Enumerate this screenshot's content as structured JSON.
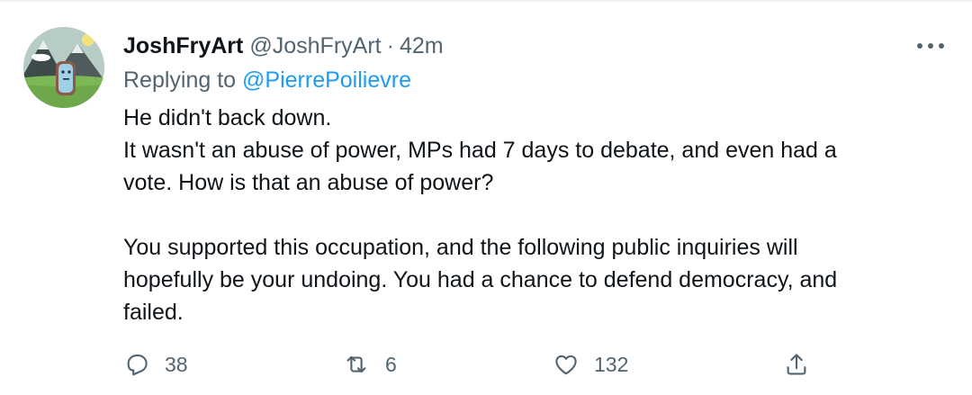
{
  "tweet": {
    "author": {
      "display_name": "JoshFryArt",
      "handle": "@JoshFryArt",
      "separator": "·",
      "time": "42m"
    },
    "replying_to": {
      "prefix": "Replying to",
      "mention": "@PierrePoilievre"
    },
    "body_lines": [
      "He didn't back down.",
      "It wasn't an abuse of power, MPs had 7 days to debate, and even had a",
      "vote. How is that an abuse of power?",
      "",
      "You supported this occupation, and the following public inquiries will",
      "hopefully be your undoing. You had a chance to defend democracy, and",
      "failed."
    ],
    "actions": {
      "reply_count": "38",
      "retweet_count": "6",
      "like_count": "132"
    }
  },
  "colors": {
    "primary_text": "#0f1419",
    "secondary_text": "#536471",
    "link": "#1d9bf0",
    "divider": "#eff3f4"
  },
  "icons": {
    "more": "more-horizontal-icon",
    "reply": "reply-icon",
    "retweet": "retweet-icon",
    "like": "heart-icon",
    "share": "share-icon"
  }
}
